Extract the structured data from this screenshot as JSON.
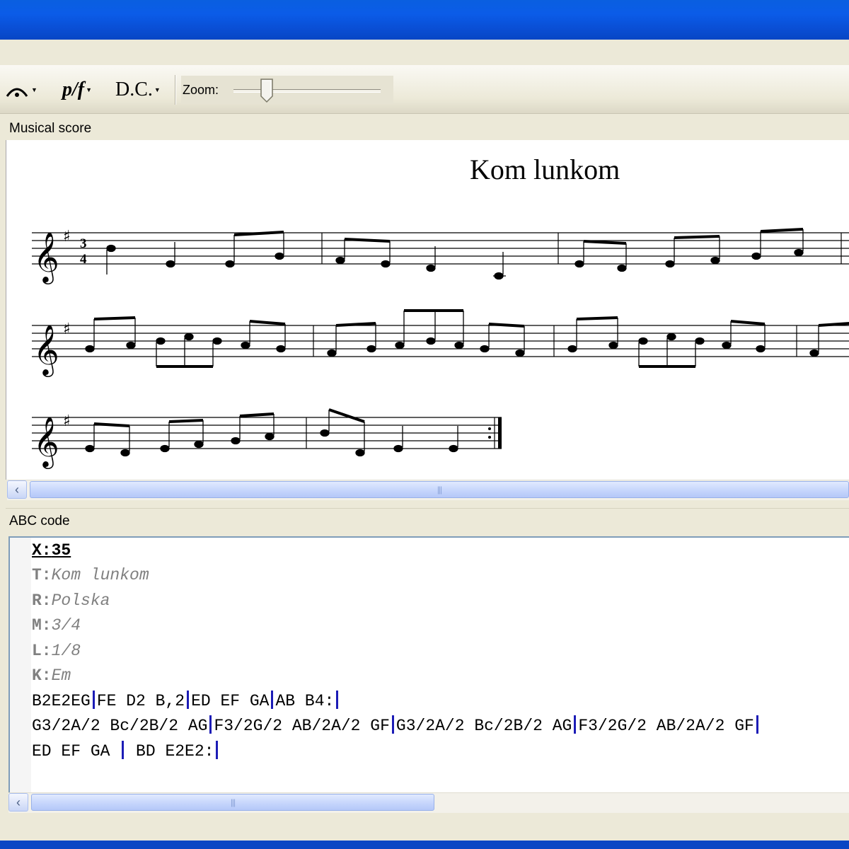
{
  "toolbar": {
    "fermata_label": "𝄐",
    "dynamics_label": "p/f",
    "dc_label": "D.C.",
    "zoom_label": "Zoom:",
    "zoom_level": 0.2
  },
  "score_panel": {
    "header": "Musical score",
    "title": "Kom lunkom"
  },
  "abc_panel": {
    "header": "ABC code",
    "lines": {
      "x": {
        "key": "X:",
        "val": "35"
      },
      "t": {
        "key": "T:",
        "val": "Kom lunkom"
      },
      "r": {
        "key": "R:",
        "val": "Polska"
      },
      "m": {
        "key": "M:",
        "val": "3/4"
      },
      "l": {
        "key": "L:",
        "val": "1/8"
      },
      "k": {
        "key": "K:",
        "val": "Em"
      }
    },
    "body_lines": [
      [
        "B2E2EG",
        "FE D2 B,2",
        "ED EF GA",
        "AB B4:"
      ],
      [
        "G3/2A/2 Bc/2B/2 AG",
        "F3/2G/2 AB/2A/2 GF",
        "G3/2A/2 Bc/2B/2 AG",
        "F3/2G/2 AB/2A/2 GF"
      ],
      [
        "ED EF GA ",
        " BD E2E2:"
      ]
    ]
  }
}
